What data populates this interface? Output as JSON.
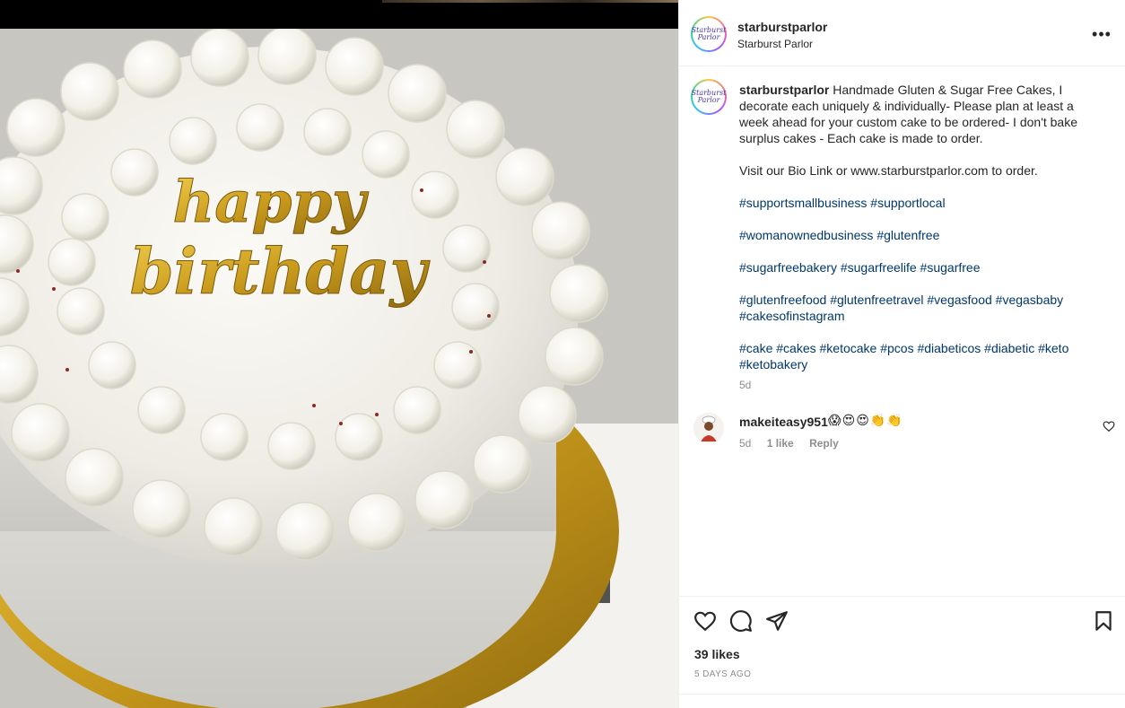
{
  "photo": {
    "topper_text": "happy birthday"
  },
  "header": {
    "avatar_text": "Starburst Parlor",
    "username": "starburstparlor",
    "subtitle": "Starburst Parlor",
    "more_label": "•••"
  },
  "caption": {
    "username": "starburstparlor",
    "text_1": "Handmade Gluten & Sugar Free Cakes, I decorate each uniquely & individually- Please plan at least a week ahead for your custom cake to be ordered- I don't bake surplus cakes - Each cake is made to order.",
    "text_2": "Visit our Bio Link or www.starburstparlor.com to order.",
    "hashtags_1": "#supportsmallbusiness #supportlocal",
    "hashtags_2": "#womanownedbusiness #glutenfree",
    "hashtags_3": "#sugarfreebakery #sugarfreelife #sugarfree",
    "hashtags_4": "#glutenfreefood #glutenfreetravel #vegasfood #vegasbaby #cakesofinstagram",
    "hashtags_5": "#cake #cakes #ketocake #pcos #diabeticos #diabetic #keto #ketobakery",
    "time": "5d"
  },
  "comment": {
    "username": "makeiteasy951",
    "emojis": "😱😍😍👏👏",
    "time": "5d",
    "likes": "1 like",
    "reply": "Reply"
  },
  "actions": {
    "likes": "39 likes",
    "date": "5 DAYS AGO"
  },
  "icons": [
    "more-icon",
    "heart-icon",
    "comment-icon",
    "share-icon",
    "bookmark-icon"
  ],
  "colors": {
    "hashtag": "#00376b",
    "text": "#262626",
    "muted": "#8e8e8e",
    "border": "#efefef"
  }
}
